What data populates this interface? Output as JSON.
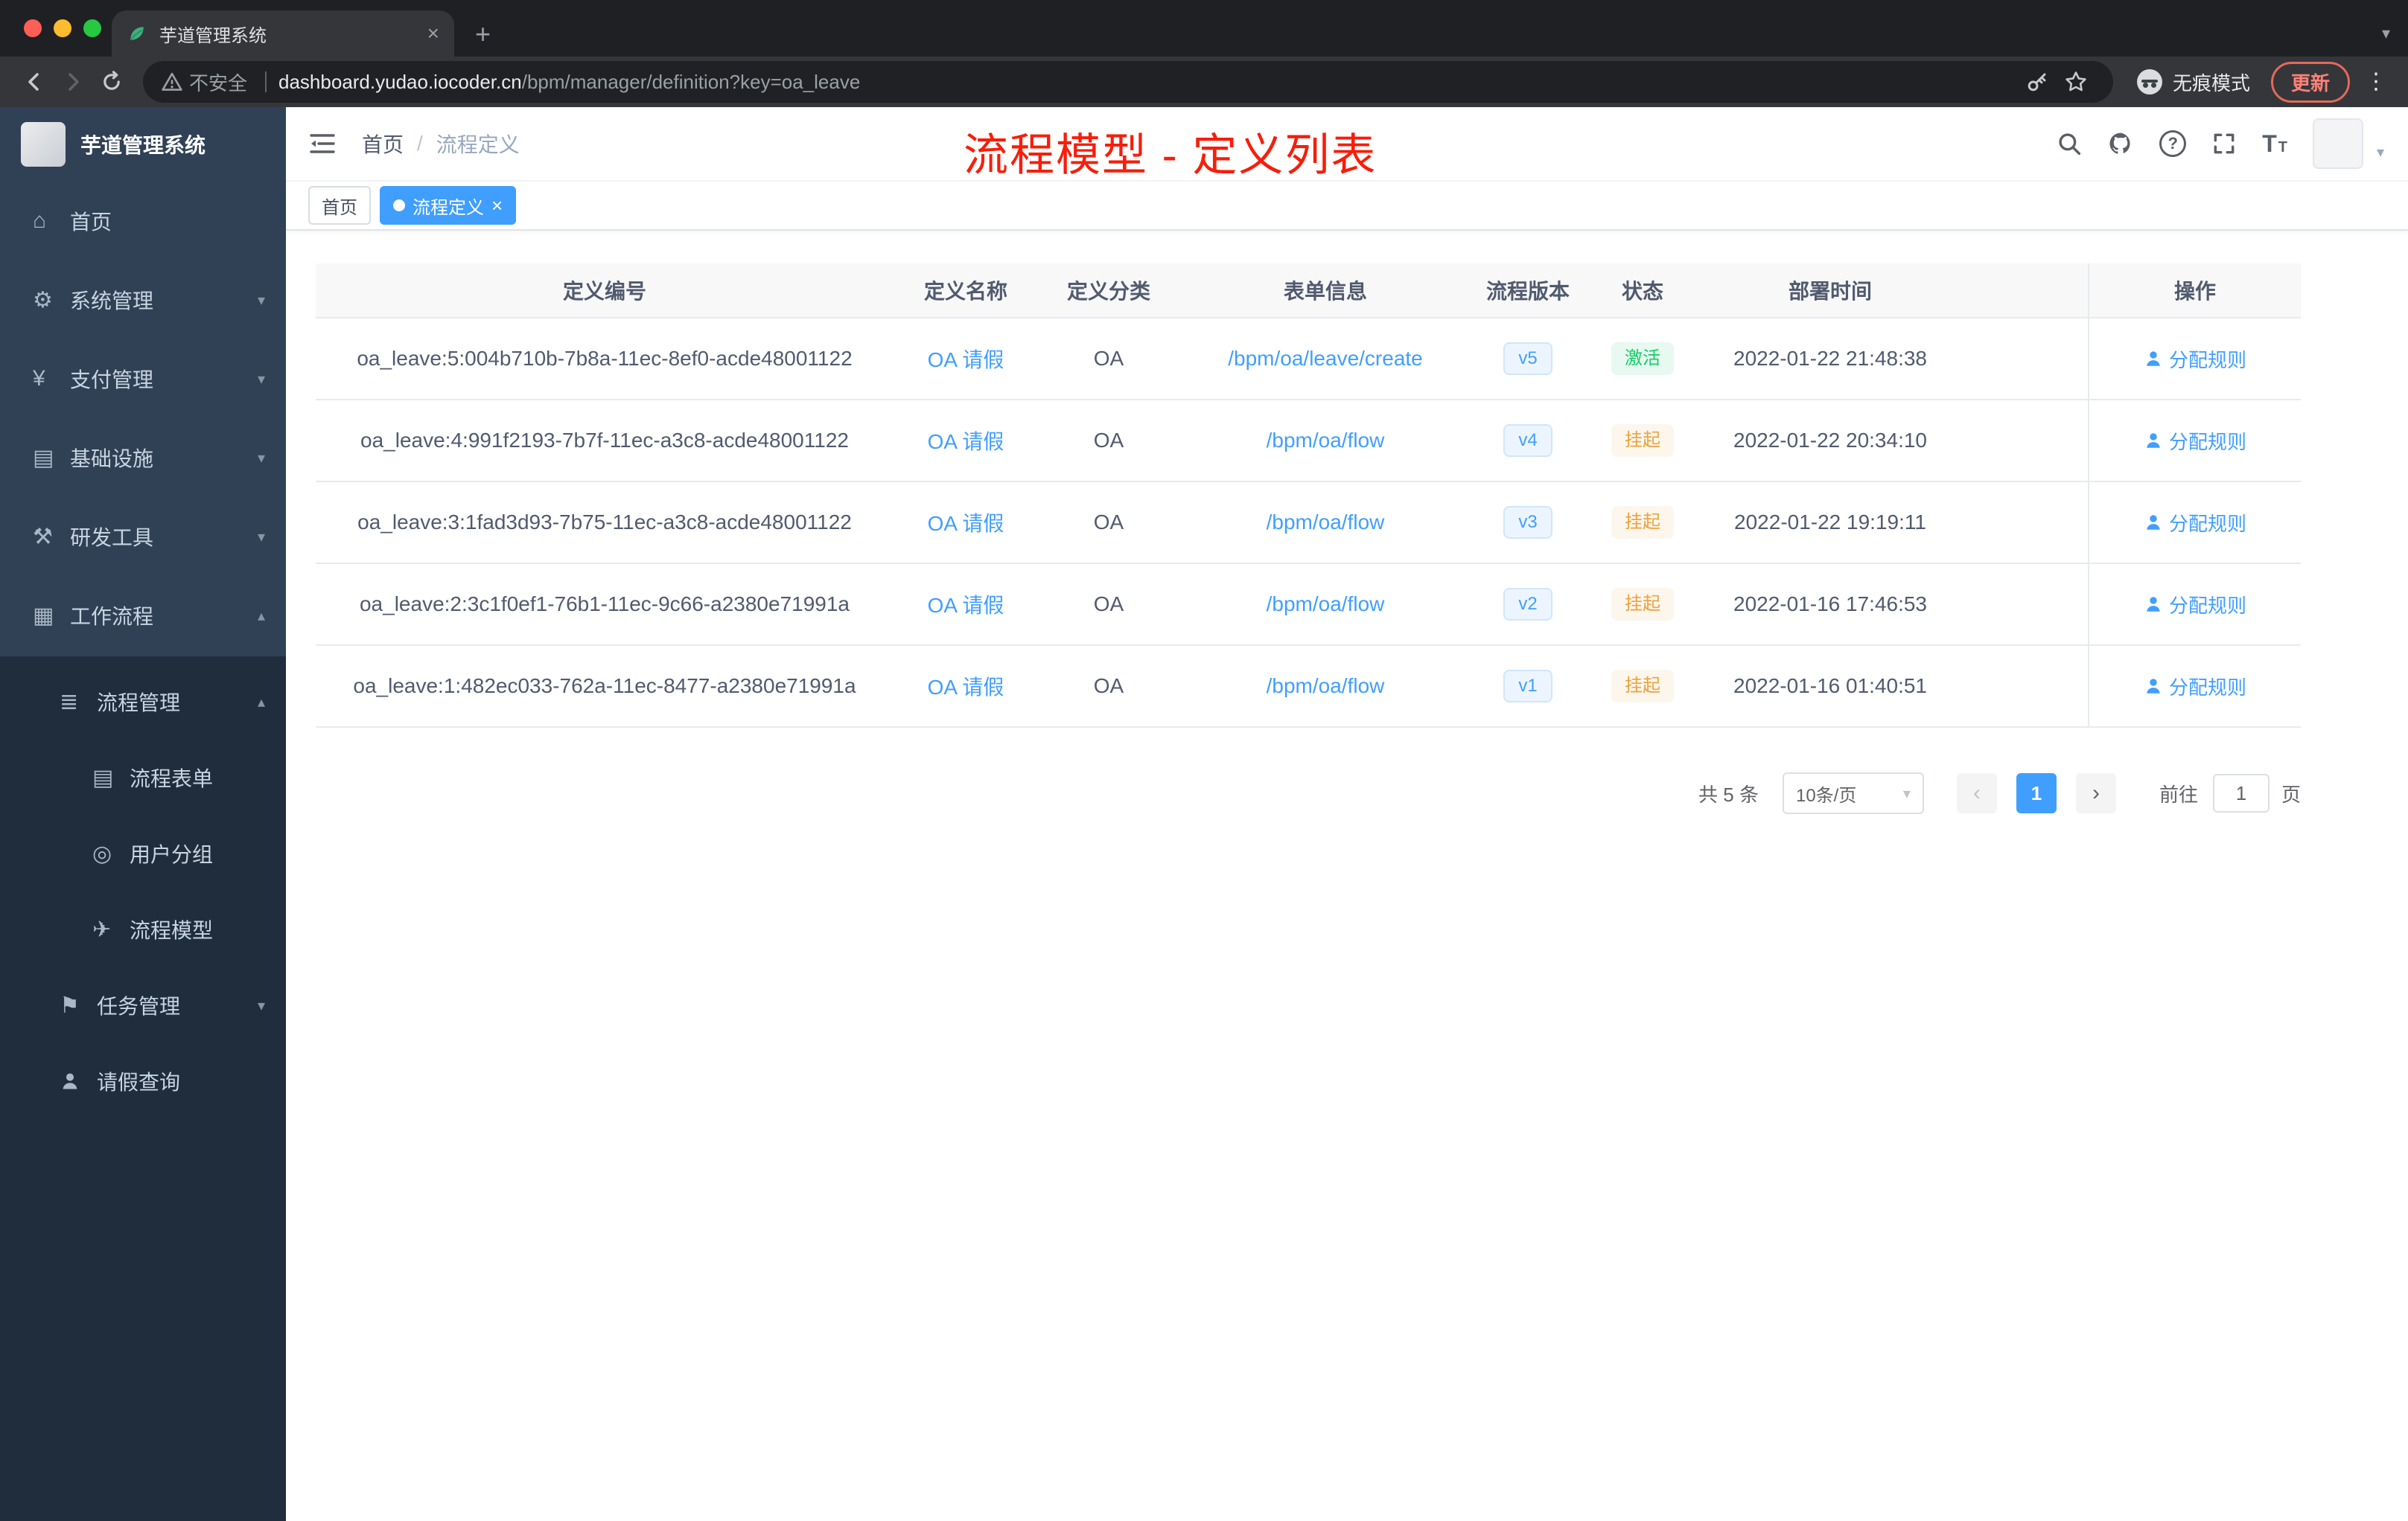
{
  "browser": {
    "tab_title": "芋道管理系统",
    "security_label": "不安全",
    "url_host": "dashboard.yudao.iocoder.cn",
    "url_path": "/bpm/manager/definition?key=oa_leave",
    "incognito_label": "无痕模式",
    "update_label": "更新"
  },
  "glyphs": {
    "close": "×",
    "plus": "+",
    "dots": "⋮",
    "caret_down": "▾",
    "caret_up": "▴",
    "chevron_left": "‹",
    "chevron_right": "›",
    "question": "?",
    "letter_T": "T"
  },
  "sidebar": {
    "logo_title": "芋道管理系统",
    "menu": [
      {
        "label": "首页",
        "icon": "⌂"
      },
      {
        "label": "系统管理",
        "icon": "⚙"
      },
      {
        "label": "支付管理",
        "icon": "¥"
      },
      {
        "label": "基础设施",
        "icon": "▤"
      },
      {
        "label": "研发工具",
        "icon": "⚒"
      },
      {
        "label": "工作流程",
        "icon": "▦"
      }
    ],
    "submenu": [
      {
        "label": "流程管理",
        "icon": "≣"
      },
      {
        "label": "流程表单",
        "icon": "▤"
      },
      {
        "label": "用户分组",
        "icon": "◎"
      },
      {
        "label": "流程模型",
        "icon": "✈"
      },
      {
        "label": "任务管理",
        "icon": "⚑"
      },
      {
        "label": "请假查询",
        "icon": "person"
      }
    ]
  },
  "header": {
    "breadcrumb": {
      "home": "首页",
      "sep": "/",
      "current": "流程定义"
    },
    "annotation": "流程模型 - 定义列表"
  },
  "tags": {
    "home": "首页",
    "active": "流程定义"
  },
  "table": {
    "columns": [
      "定义编号",
      "定义名称",
      "定义分类",
      "表单信息",
      "流程版本",
      "状态",
      "部署时间",
      "操作"
    ],
    "action_label": "分配规则",
    "rows": [
      {
        "id": "oa_leave:5:004b710b-7b8a-11ec-8ef0-acde48001122",
        "name": "OA 请假",
        "category": "OA",
        "form": "/bpm/oa/leave/create",
        "version": "v5",
        "status": "激活",
        "status_type": "success",
        "time": "2022-01-22 21:48:38"
      },
      {
        "id": "oa_leave:4:991f2193-7b7f-11ec-a3c8-acde48001122",
        "name": "OA 请假",
        "category": "OA",
        "form": "/bpm/oa/flow",
        "version": "v4",
        "status": "挂起",
        "status_type": "warning",
        "time": "2022-01-22 20:34:10"
      },
      {
        "id": "oa_leave:3:1fad3d93-7b75-11ec-a3c8-acde48001122",
        "name": "OA 请假",
        "category": "OA",
        "form": "/bpm/oa/flow",
        "version": "v3",
        "status": "挂起",
        "status_type": "warning",
        "time": "2022-01-22 19:19:11"
      },
      {
        "id": "oa_leave:2:3c1f0ef1-76b1-11ec-9c66-a2380e71991a",
        "name": "OA 请假",
        "category": "OA",
        "form": "/bpm/oa/flow",
        "version": "v2",
        "status": "挂起",
        "status_type": "warning",
        "time": "2022-01-16 17:46:53"
      },
      {
        "id": "oa_leave:1:482ec033-762a-11ec-8477-a2380e71991a",
        "name": "OA 请假",
        "category": "OA",
        "form": "/bpm/oa/flow",
        "version": "v1",
        "status": "挂起",
        "status_type": "warning",
        "time": "2022-01-16 01:40:51"
      }
    ]
  },
  "pagination": {
    "total": "共 5 条",
    "page_size": "10条/页",
    "page": "1",
    "goto": "前往",
    "unit": "页",
    "goto_value": "1"
  },
  "colors": {
    "accent": "#409eff",
    "success_text": "#13ce66",
    "warning_text": "#e6a23c",
    "annotation_red": "#f81d0a",
    "sidebar_bg": "#304156",
    "sidebar_sub_bg": "#1f2d3d",
    "tag_active_bg": "#409eff"
  }
}
